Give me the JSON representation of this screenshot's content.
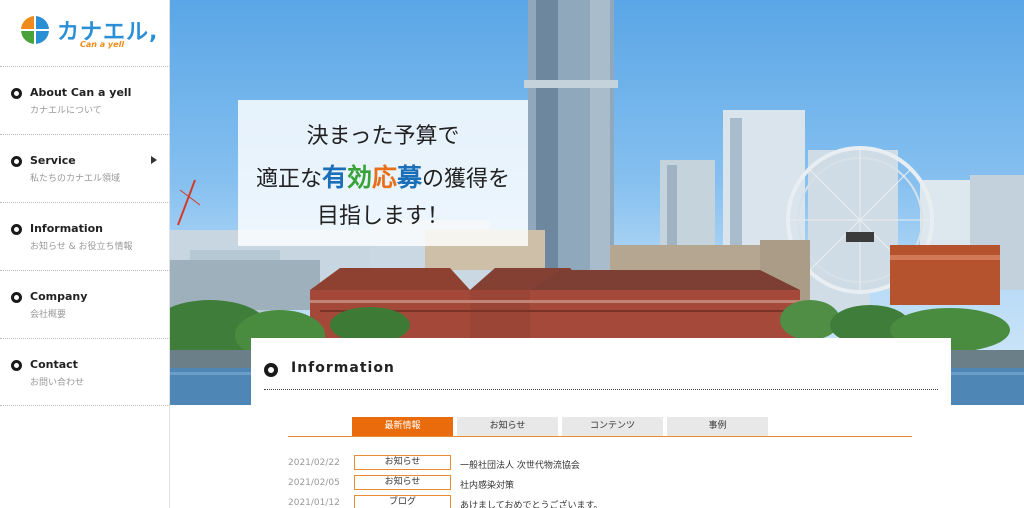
{
  "brand": {
    "name": "カナエル,",
    "tagline": "Can a yell",
    "colors": {
      "blue": "#2b8fd6",
      "orange": "#f08a1a",
      "green": "#4aa33a",
      "red": "#e23d28"
    }
  },
  "nav": {
    "items": [
      {
        "label": "About Can a yell",
        "sub": "カナエルについて"
      },
      {
        "label": "Service",
        "sub": "私たちのカナエル領域"
      },
      {
        "label": "Information",
        "sub": "お知らせ & お役立ち情報"
      },
      {
        "label": "Company",
        "sub": "会社概要"
      },
      {
        "label": "Contact",
        "sub": "お問い合わせ"
      }
    ]
  },
  "hero": {
    "line1": "決まった予算で",
    "line2_pre": "適正な",
    "line2_h1": "有",
    "line2_h2": "効",
    "line2_h3": "応",
    "line2_h4": "募",
    "line2_post": "の獲得を",
    "line3": "目指します！",
    "highlight_colors": [
      "#1a6fb8",
      "#39a33a",
      "#e8701a",
      "#1a6fb8"
    ]
  },
  "information": {
    "title": "Information",
    "tabs": [
      "最新情報",
      "お知らせ",
      "コンテンツ",
      "事例"
    ],
    "active_tab": "最新情報",
    "accent": "#ea6b0b",
    "news": [
      {
        "date": "2021/02/22",
        "tag": "お知らせ",
        "text": "一般社団法人 次世代物流協会"
      },
      {
        "date": "2021/02/05",
        "tag": "お知らせ",
        "text": "社内感染対策"
      },
      {
        "date": "2021/01/12",
        "tag": "ブログ",
        "text": "あけましておめでとうございます。"
      }
    ]
  }
}
